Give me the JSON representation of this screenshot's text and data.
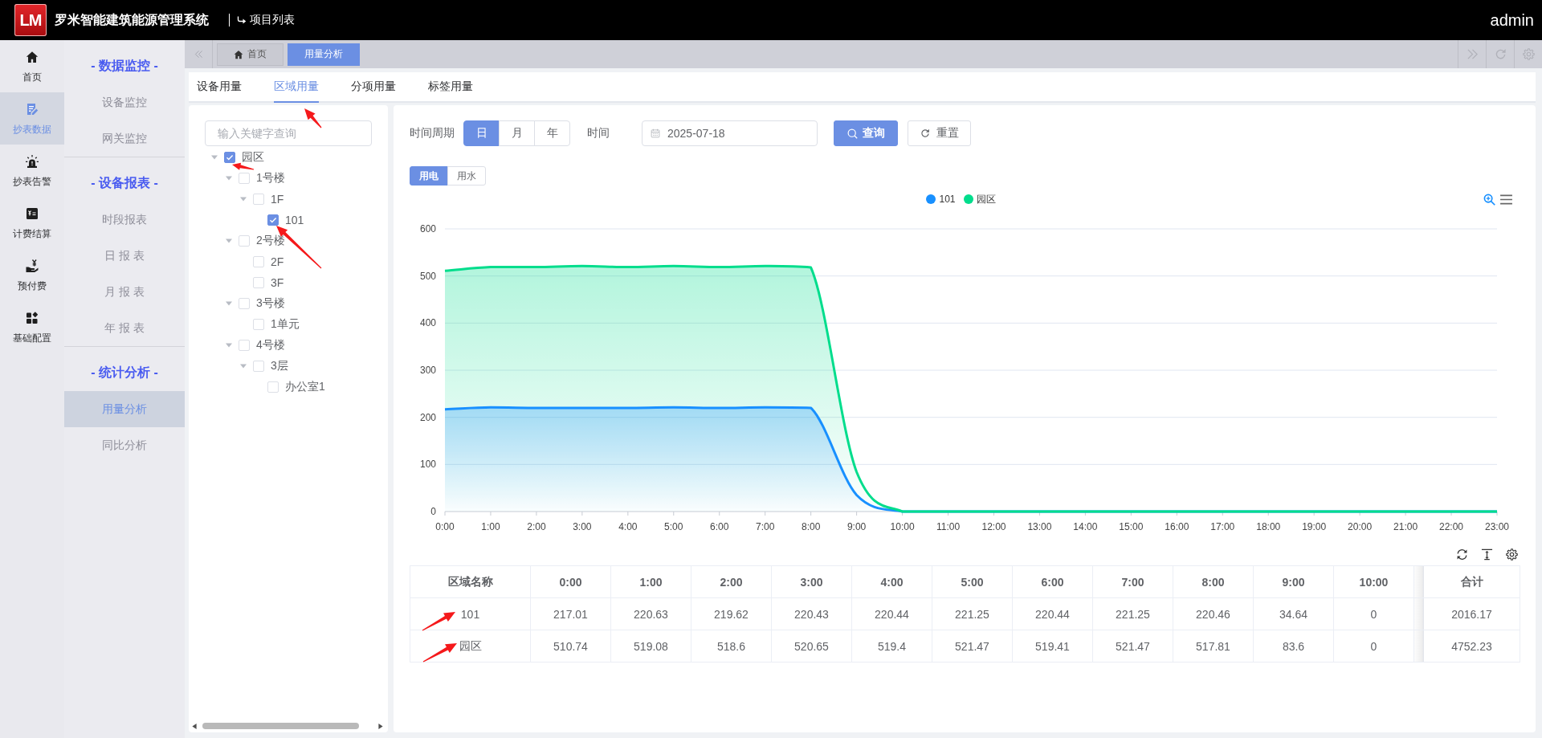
{
  "header": {
    "logo": "LM",
    "title": "罗米智能建筑能源管理系统",
    "project_link": "项目列表",
    "user": "admin"
  },
  "icon_nav": [
    {
      "label": "首页",
      "selected": false
    },
    {
      "label": "抄表数据",
      "selected": true
    },
    {
      "label": "抄表告警",
      "selected": false
    },
    {
      "label": "计费结算",
      "selected": false
    },
    {
      "label": "预付费",
      "selected": false
    },
    {
      "label": "基础配置",
      "selected": false
    }
  ],
  "sub_nav": [
    {
      "title": "- 数据监控 -",
      "items": [
        {
          "label": "设备监控",
          "selected": false
        },
        {
          "label": "网关监控",
          "selected": false
        }
      ]
    },
    {
      "title": "- 设备报表 -",
      "items": [
        {
          "label": "时段报表",
          "selected": false
        },
        {
          "label": "日 报 表",
          "selected": false
        },
        {
          "label": "月 报 表",
          "selected": false
        },
        {
          "label": "年 报 表",
          "selected": false
        }
      ]
    },
    {
      "title": "- 统计分析 -",
      "items": [
        {
          "label": "用量分析",
          "selected": true
        },
        {
          "label": "同比分析",
          "selected": false
        }
      ]
    }
  ],
  "page_tabs": [
    {
      "label": "首页",
      "selected": false
    },
    {
      "label": "用量分析",
      "selected": true
    }
  ],
  "usage_tabs": [
    {
      "label": "设备用量",
      "selected": false
    },
    {
      "label": "区域用量",
      "selected": true
    },
    {
      "label": "分项用量",
      "selected": false
    },
    {
      "label": "标签用量",
      "selected": false
    }
  ],
  "tree": {
    "search": {
      "placeholder": "输入关键字查询"
    },
    "nodes": [
      {
        "label": "园区",
        "checked": true,
        "expanded": true,
        "children": [
          {
            "label": "1号楼",
            "checked": false,
            "expanded": true,
            "children": [
              {
                "label": "1F",
                "checked": false,
                "expanded": true,
                "children": [
                  {
                    "label": "101",
                    "checked": true
                  }
                ]
              }
            ]
          },
          {
            "label": "2号楼",
            "checked": false,
            "expanded": true,
            "children": [
              {
                "label": "2F",
                "checked": false
              },
              {
                "label": "3F",
                "checked": false
              }
            ]
          },
          {
            "label": "3号楼",
            "checked": false,
            "expanded": true,
            "children": [
              {
                "label": "1单元",
                "checked": false
              }
            ]
          },
          {
            "label": "4号楼",
            "checked": false,
            "expanded": true,
            "children": [
              {
                "label": "3层",
                "checked": false,
                "expanded": true,
                "children": [
                  {
                    "label": "办公室1",
                    "checked": false
                  }
                ]
              }
            ]
          }
        ]
      }
    ]
  },
  "query": {
    "period_label": "时间周期",
    "periods": [
      {
        "label": "日",
        "selected": true
      },
      {
        "label": "月",
        "selected": false
      },
      {
        "label": "年",
        "selected": false
      }
    ],
    "date_label": "时间",
    "date": "2025-07-18",
    "search_button": "查询",
    "reset_button": "重置"
  },
  "energy_types": [
    {
      "label": "用电",
      "selected": true
    },
    {
      "label": "用水",
      "selected": false
    }
  ],
  "chart": {
    "chart_data": {
      "type": "area",
      "x": [
        "0:00",
        "1:00",
        "2:00",
        "3:00",
        "4:00",
        "5:00",
        "6:00",
        "7:00",
        "8:00",
        "9:00",
        "10:00",
        "11:00",
        "12:00",
        "13:00",
        "14:00",
        "15:00",
        "16:00",
        "17:00",
        "18:00",
        "19:00",
        "20:00",
        "21:00",
        "22:00",
        "23:00"
      ],
      "series": [
        {
          "name": "101",
          "color": "#1890ff",
          "values": [
            217,
            221,
            220,
            220,
            220,
            221,
            220,
            221,
            220,
            35,
            0,
            0,
            0,
            0,
            0,
            0,
            0,
            0,
            0,
            0,
            0,
            0,
            0,
            0
          ]
        },
        {
          "name": "园区",
          "color": "#00dd8c",
          "values": [
            511,
            519,
            519,
            521,
            519,
            521,
            519,
            521,
            518,
            84,
            0,
            0,
            0,
            0,
            0,
            0,
            0,
            0,
            0,
            0,
            0,
            0,
            0,
            0
          ]
        }
      ],
      "ylim": [
        0,
        600
      ],
      "yticks": [
        0,
        100,
        200,
        300,
        400,
        500,
        600
      ],
      "grid": true,
      "legend": "top"
    }
  },
  "table": {
    "columns": [
      "区域名称",
      "0:00",
      "1:00",
      "2:00",
      "3:00",
      "4:00",
      "5:00",
      "6:00",
      "7:00",
      "8:00",
      "9:00",
      "10:00"
    ],
    "total_column": "合计",
    "rows": [
      {
        "name": "101",
        "values": [
          "217.01",
          "220.63",
          "219.62",
          "220.43",
          "220.44",
          "221.25",
          "220.44",
          "221.25",
          "220.46",
          "34.64",
          "0"
        ],
        "total": "2016.17"
      },
      {
        "name": "园区",
        "values": [
          "510.74",
          "519.08",
          "518.6",
          "520.65",
          "519.4",
          "521.47",
          "519.41",
          "521.47",
          "517.81",
          "83.6",
          "0"
        ],
        "total": "4752.23"
      }
    ]
  }
}
